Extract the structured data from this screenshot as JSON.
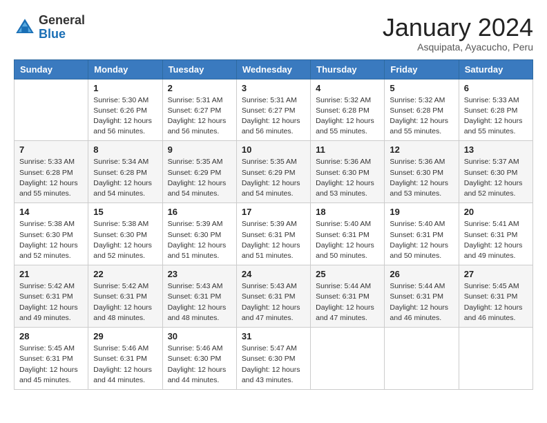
{
  "header": {
    "logo_general": "General",
    "logo_blue": "Blue",
    "month_title": "January 2024",
    "subtitle": "Asquipata, Ayacucho, Peru"
  },
  "days_of_week": [
    "Sunday",
    "Monday",
    "Tuesday",
    "Wednesday",
    "Thursday",
    "Friday",
    "Saturday"
  ],
  "weeks": [
    [
      {
        "day": "",
        "info": ""
      },
      {
        "day": "1",
        "info": "Sunrise: 5:30 AM\nSunset: 6:26 PM\nDaylight: 12 hours\nand 56 minutes."
      },
      {
        "day": "2",
        "info": "Sunrise: 5:31 AM\nSunset: 6:27 PM\nDaylight: 12 hours\nand 56 minutes."
      },
      {
        "day": "3",
        "info": "Sunrise: 5:31 AM\nSunset: 6:27 PM\nDaylight: 12 hours\nand 56 minutes."
      },
      {
        "day": "4",
        "info": "Sunrise: 5:32 AM\nSunset: 6:28 PM\nDaylight: 12 hours\nand 55 minutes."
      },
      {
        "day": "5",
        "info": "Sunrise: 5:32 AM\nSunset: 6:28 PM\nDaylight: 12 hours\nand 55 minutes."
      },
      {
        "day": "6",
        "info": "Sunrise: 5:33 AM\nSunset: 6:28 PM\nDaylight: 12 hours\nand 55 minutes."
      }
    ],
    [
      {
        "day": "7",
        "info": "Sunrise: 5:33 AM\nSunset: 6:28 PM\nDaylight: 12 hours\nand 55 minutes."
      },
      {
        "day": "8",
        "info": "Sunrise: 5:34 AM\nSunset: 6:28 PM\nDaylight: 12 hours\nand 54 minutes."
      },
      {
        "day": "9",
        "info": "Sunrise: 5:35 AM\nSunset: 6:29 PM\nDaylight: 12 hours\nand 54 minutes."
      },
      {
        "day": "10",
        "info": "Sunrise: 5:35 AM\nSunset: 6:29 PM\nDaylight: 12 hours\nand 54 minutes."
      },
      {
        "day": "11",
        "info": "Sunrise: 5:36 AM\nSunset: 6:30 PM\nDaylight: 12 hours\nand 53 minutes."
      },
      {
        "day": "12",
        "info": "Sunrise: 5:36 AM\nSunset: 6:30 PM\nDaylight: 12 hours\nand 53 minutes."
      },
      {
        "day": "13",
        "info": "Sunrise: 5:37 AM\nSunset: 6:30 PM\nDaylight: 12 hours\nand 52 minutes."
      }
    ],
    [
      {
        "day": "14",
        "info": "Sunrise: 5:38 AM\nSunset: 6:30 PM\nDaylight: 12 hours\nand 52 minutes."
      },
      {
        "day": "15",
        "info": "Sunrise: 5:38 AM\nSunset: 6:30 PM\nDaylight: 12 hours\nand 52 minutes."
      },
      {
        "day": "16",
        "info": "Sunrise: 5:39 AM\nSunset: 6:30 PM\nDaylight: 12 hours\nand 51 minutes."
      },
      {
        "day": "17",
        "info": "Sunrise: 5:39 AM\nSunset: 6:31 PM\nDaylight: 12 hours\nand 51 minutes."
      },
      {
        "day": "18",
        "info": "Sunrise: 5:40 AM\nSunset: 6:31 PM\nDaylight: 12 hours\nand 50 minutes."
      },
      {
        "day": "19",
        "info": "Sunrise: 5:40 AM\nSunset: 6:31 PM\nDaylight: 12 hours\nand 50 minutes."
      },
      {
        "day": "20",
        "info": "Sunrise: 5:41 AM\nSunset: 6:31 PM\nDaylight: 12 hours\nand 49 minutes."
      }
    ],
    [
      {
        "day": "21",
        "info": "Sunrise: 5:42 AM\nSunset: 6:31 PM\nDaylight: 12 hours\nand 49 minutes."
      },
      {
        "day": "22",
        "info": "Sunrise: 5:42 AM\nSunset: 6:31 PM\nDaylight: 12 hours\nand 48 minutes."
      },
      {
        "day": "23",
        "info": "Sunrise: 5:43 AM\nSunset: 6:31 PM\nDaylight: 12 hours\nand 48 minutes."
      },
      {
        "day": "24",
        "info": "Sunrise: 5:43 AM\nSunset: 6:31 PM\nDaylight: 12 hours\nand 47 minutes."
      },
      {
        "day": "25",
        "info": "Sunrise: 5:44 AM\nSunset: 6:31 PM\nDaylight: 12 hours\nand 47 minutes."
      },
      {
        "day": "26",
        "info": "Sunrise: 5:44 AM\nSunset: 6:31 PM\nDaylight: 12 hours\nand 46 minutes."
      },
      {
        "day": "27",
        "info": "Sunrise: 5:45 AM\nSunset: 6:31 PM\nDaylight: 12 hours\nand 46 minutes."
      }
    ],
    [
      {
        "day": "28",
        "info": "Sunrise: 5:45 AM\nSunset: 6:31 PM\nDaylight: 12 hours\nand 45 minutes."
      },
      {
        "day": "29",
        "info": "Sunrise: 5:46 AM\nSunset: 6:31 PM\nDaylight: 12 hours\nand 44 minutes."
      },
      {
        "day": "30",
        "info": "Sunrise: 5:46 AM\nSunset: 6:30 PM\nDaylight: 12 hours\nand 44 minutes."
      },
      {
        "day": "31",
        "info": "Sunrise: 5:47 AM\nSunset: 6:30 PM\nDaylight: 12 hours\nand 43 minutes."
      },
      {
        "day": "",
        "info": ""
      },
      {
        "day": "",
        "info": ""
      },
      {
        "day": "",
        "info": ""
      }
    ]
  ]
}
